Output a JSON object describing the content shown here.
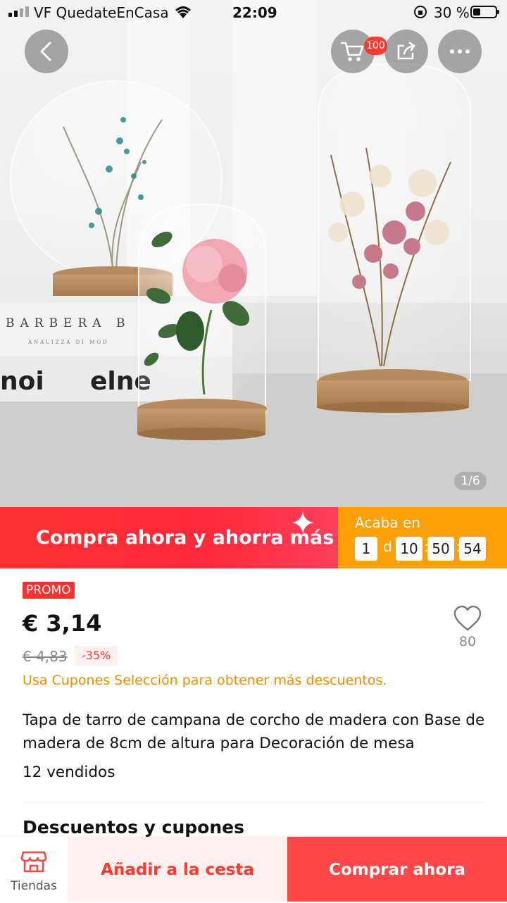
{
  "status_bar": {
    "carrier": "VF QuedateEnCasa",
    "time": "22:09",
    "battery": "30 %"
  },
  "header": {
    "cart_badge": "100",
    "photo_counter": "1/6",
    "icons": [
      "back-arrow-icon",
      "cart-icon",
      "share-icon",
      "more-icon"
    ]
  },
  "hero_image": {
    "book_spine_text": "BARBERA B",
    "book_spine_subtext": "ANALIZZA DI MOD",
    "magazine_text": "noi",
    "magazine_text2": "elne"
  },
  "banner": {
    "text": "Compra ahora y ahorra más",
    "ends_label": "Acaba en",
    "days": "1",
    "day_unit": "d",
    "hours": "10",
    "minutes": "50",
    "seconds": "54"
  },
  "product": {
    "promo_tag": "PROMO",
    "price": "€ 3,14",
    "old_price": "€ 4,83",
    "discount": "-35%",
    "wishlist_count": "80",
    "coupon_note": "Usa Cupones Selección para obtener más descuentos.",
    "title": "Tapa de tarro de campana de corcho de madera con Base de madera de 8cm de altura para Decoración de mesa",
    "sold": "12 vendidos"
  },
  "sections": {
    "discounts_title": "Descuentos y cupones"
  },
  "bottom_bar": {
    "store_label": "Tiendas",
    "add_to_cart": "Añadir a la cesta",
    "buy_now": "Comprar ahora"
  },
  "colors": {
    "accent_red": "#ff3b30",
    "banner_orange": "#ff9f0a",
    "coupon_orange": "#f28c00"
  }
}
